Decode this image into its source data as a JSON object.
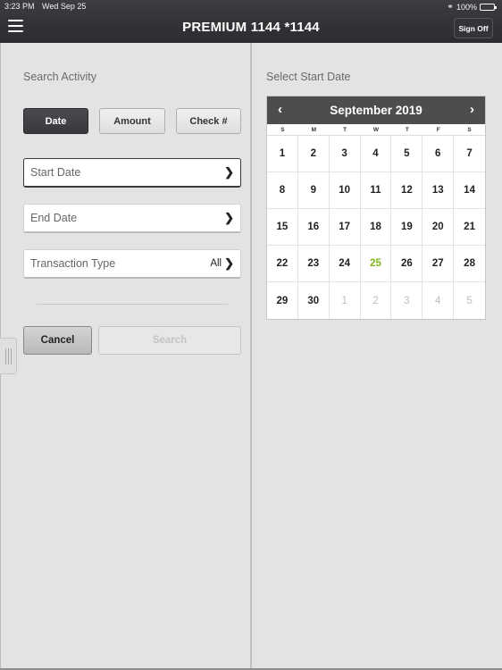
{
  "status_bar": {
    "time": "3:23 PM",
    "date": "Wed Sep 25",
    "battery": "100%",
    "battery_level": 1.0
  },
  "header": {
    "title": "PREMIUM 1144 *1144",
    "menu_icon": "hamburger-icon",
    "sign_off_label": "Sign Off"
  },
  "left_panel": {
    "section_label": "Search Activity",
    "segments": [
      {
        "label": "Date",
        "active": true
      },
      {
        "label": "Amount",
        "active": false
      },
      {
        "label": "Check #",
        "active": false
      }
    ],
    "fields": [
      {
        "label": "Start Date",
        "value": "",
        "focused": true
      },
      {
        "label": "End Date",
        "value": "",
        "focused": false
      },
      {
        "label": "Transaction Type",
        "value": "All",
        "focused": false
      }
    ],
    "cancel_label": "Cancel",
    "search_label": "Search"
  },
  "right_panel": {
    "section_label": "Select Start Date",
    "calendar": {
      "month_label": "September 2019",
      "prev_icon": "chevron-left-icon",
      "next_icon": "chevron-right-icon",
      "weekdays": [
        "S",
        "M",
        "T",
        "W",
        "T",
        "F",
        "S"
      ],
      "today": 25,
      "days": [
        {
          "d": "1",
          "other": false
        },
        {
          "d": "2",
          "other": false
        },
        {
          "d": "3",
          "other": false
        },
        {
          "d": "4",
          "other": false
        },
        {
          "d": "5",
          "other": false
        },
        {
          "d": "6",
          "other": false
        },
        {
          "d": "7",
          "other": false
        },
        {
          "d": "8",
          "other": false
        },
        {
          "d": "9",
          "other": false
        },
        {
          "d": "10",
          "other": false
        },
        {
          "d": "11",
          "other": false
        },
        {
          "d": "12",
          "other": false
        },
        {
          "d": "13",
          "other": false
        },
        {
          "d": "14",
          "other": false
        },
        {
          "d": "15",
          "other": false
        },
        {
          "d": "16",
          "other": false
        },
        {
          "d": "17",
          "other": false
        },
        {
          "d": "18",
          "other": false
        },
        {
          "d": "19",
          "other": false
        },
        {
          "d": "20",
          "other": false
        },
        {
          "d": "21",
          "other": false
        },
        {
          "d": "22",
          "other": false
        },
        {
          "d": "23",
          "other": false
        },
        {
          "d": "24",
          "other": false
        },
        {
          "d": "25",
          "other": false
        },
        {
          "d": "26",
          "other": false
        },
        {
          "d": "27",
          "other": false
        },
        {
          "d": "28",
          "other": false
        },
        {
          "d": "29",
          "other": false
        },
        {
          "d": "30",
          "other": false
        },
        {
          "d": "1",
          "other": true
        },
        {
          "d": "2",
          "other": true
        },
        {
          "d": "3",
          "other": true
        },
        {
          "d": "4",
          "other": true
        },
        {
          "d": "5",
          "other": true
        }
      ]
    }
  },
  "colors": {
    "header_bg": "#2e2f32",
    "today_accent": "#7ab51d",
    "panel_bg": "#e4e2e3"
  }
}
